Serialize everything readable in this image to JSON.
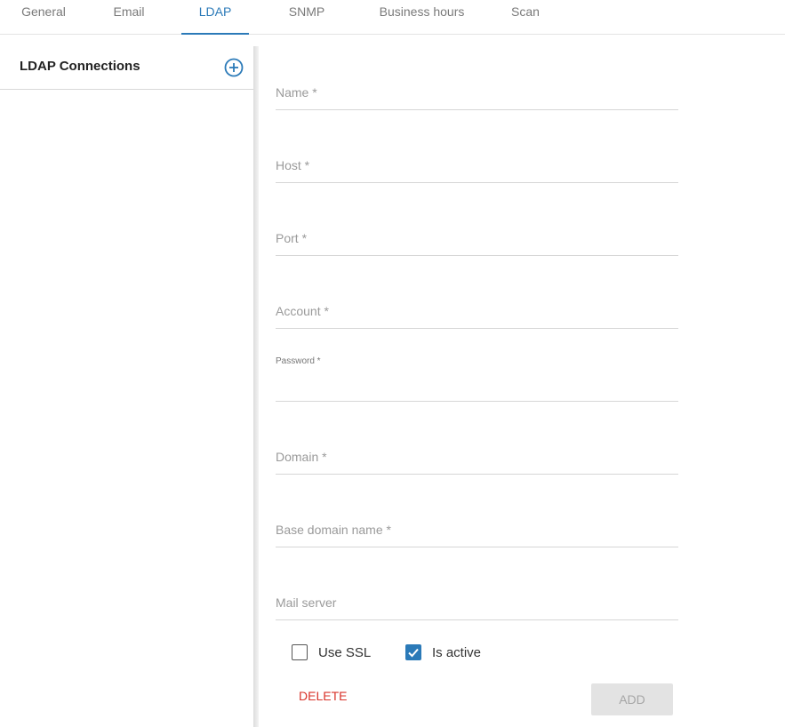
{
  "tabs": [
    {
      "label": "General",
      "active": false
    },
    {
      "label": "Email",
      "active": false
    },
    {
      "label": "LDAP",
      "active": true
    },
    {
      "label": "SNMP",
      "active": false
    },
    {
      "label": "Business hours",
      "active": false
    },
    {
      "label": "Scan",
      "active": false
    }
  ],
  "sidebar": {
    "title": "LDAP Connections",
    "add_icon": "plus-circle-icon"
  },
  "form": {
    "fields": [
      {
        "name": "name-field",
        "placeholder": "Name *",
        "value": ""
      },
      {
        "name": "host-field",
        "placeholder": "Host *",
        "value": ""
      },
      {
        "name": "port-field",
        "placeholder": "Port *",
        "value": ""
      },
      {
        "name": "account-field",
        "placeholder": "Account *",
        "value": ""
      },
      {
        "name": "password-field",
        "placeholder": "Password *",
        "value": ""
      },
      {
        "name": "domain-field",
        "placeholder": "Domain *",
        "value": ""
      },
      {
        "name": "base-domain-name-field",
        "placeholder": "Base domain name *",
        "value": ""
      },
      {
        "name": "mail-server-field",
        "placeholder": "Mail server",
        "value": ""
      }
    ],
    "checkboxes": [
      {
        "label": "Use SSL",
        "checked": false
      },
      {
        "label": "Is active",
        "checked": true
      }
    ],
    "delete_label": "DELETE",
    "add_label": "ADD"
  },
  "colors": {
    "accent": "#2b7ab8",
    "danger": "#d9342b",
    "disabled_bg": "#e3e3e3"
  }
}
